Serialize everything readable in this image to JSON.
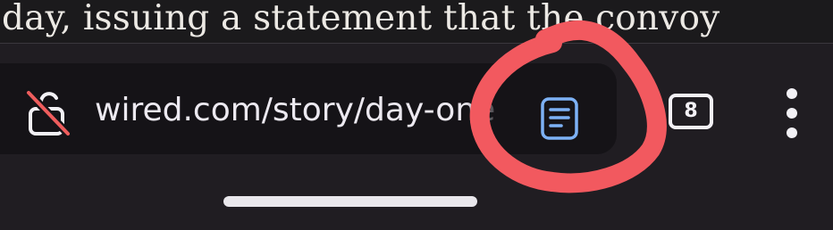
{
  "article": {
    "visible_text": "day, issuing a statement that the convoy"
  },
  "toolbar": {
    "address_bar": {
      "url": "wired.com/story/day-one",
      "security_icon": "lock-broken-icon"
    },
    "reader_mode_icon": "reader-mode-icon",
    "tab_count": "8",
    "menu_icon": "more-vert-icon"
  },
  "annotation": {
    "shape": "freehand-circle",
    "color": "#f2595f",
    "target": "reader-mode-button"
  },
  "colors": {
    "toolbar_bg": "#201d22",
    "address_bar_bg": "#151317",
    "reader_icon": "#7db1f5",
    "foreground": "#f3f1f6"
  }
}
